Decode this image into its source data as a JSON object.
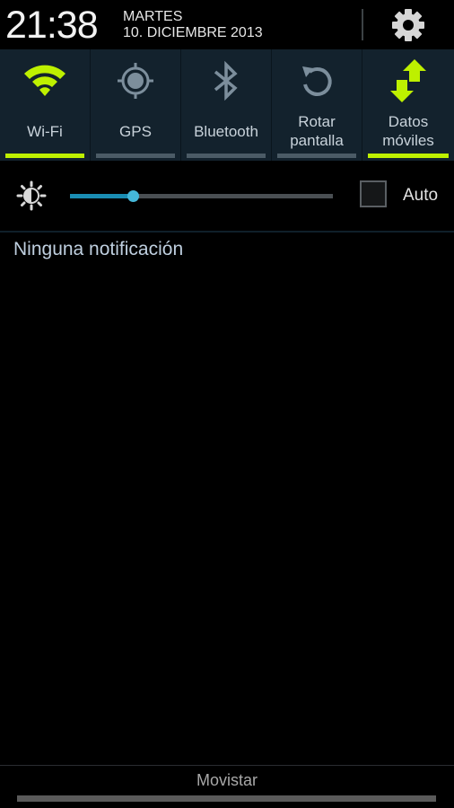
{
  "header": {
    "time": "21:38",
    "weekday": "MARTES",
    "date": "10. DICIEMBRE 2013",
    "settings_icon": "gear-icon"
  },
  "quick_toggles": [
    {
      "label": "Wi-Fi",
      "icon": "wifi-icon",
      "state": "on"
    },
    {
      "label": "GPS",
      "icon": "gps-icon",
      "state": "off"
    },
    {
      "label": "Bluetooth",
      "icon": "bluetooth-icon",
      "state": "off"
    },
    {
      "label": "Rotar pantalla",
      "label_line1": "Rotar",
      "label_line2": "pantalla",
      "icon": "rotate-icon",
      "state": "off"
    },
    {
      "label": "Datos móviles",
      "label_line1": "Datos",
      "label_line2": "móviles",
      "icon": "mobile-data-icon",
      "state": "on"
    }
  ],
  "brightness": {
    "icon": "brightness-icon",
    "level_percent": 24,
    "auto_label": "Auto",
    "auto_checked": false
  },
  "notifications": {
    "empty_text": "Ninguna notificación"
  },
  "footer": {
    "carrier": "Movistar"
  },
  "colors": {
    "accent_on": "#bef000",
    "toggle_off_bar": "#4b5b66",
    "toggle_bg": "#13222d",
    "slider_fill": "#1a8db3",
    "slider_thumb": "#45b7d9"
  }
}
